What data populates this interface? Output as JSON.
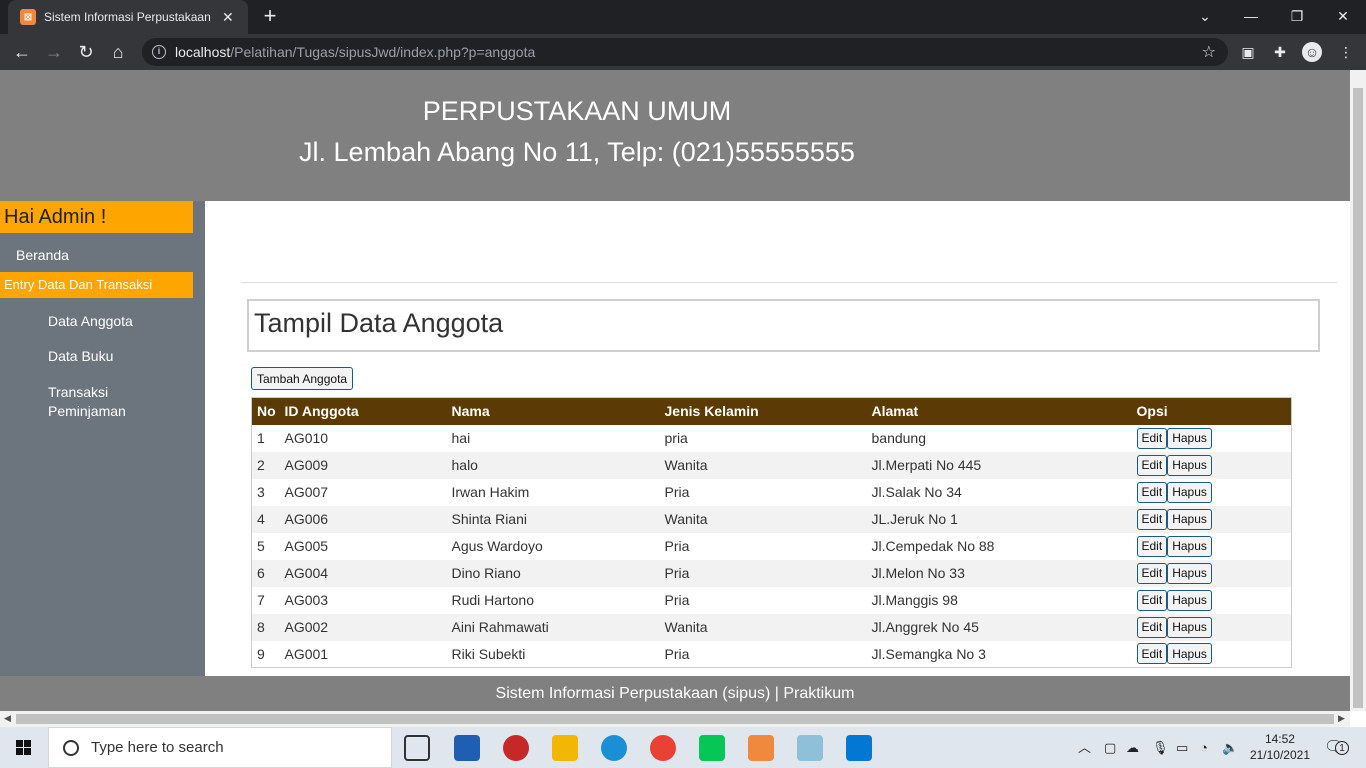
{
  "browser": {
    "tab_title": "Sistem Informasi Perpustakaan",
    "tab_close": "✕",
    "new_tab": "+",
    "url_host": "localhost",
    "url_path": "/Pelatihan/Tugas/sipusJwd/index.php?p=anggota"
  },
  "header": {
    "title": "PERPUSTAKAAN UMUM",
    "address": "Jl. Lembah Abang No 11, Telp: (021)55555555"
  },
  "sidebar": {
    "greeting": "Hai Admin !",
    "home": "Beranda",
    "section": "Entry Data Dan Transaksi",
    "items": [
      {
        "label": "Data Anggota"
      },
      {
        "label": "Data Buku"
      },
      {
        "label": "Transaksi Peminjaman"
      }
    ]
  },
  "main": {
    "page_title": "Tampil Data Anggota",
    "add_button": "Tambah Anggota",
    "columns": [
      "No",
      "ID Anggota",
      "Nama",
      "Jenis Kelamin",
      "Alamat",
      "Opsi"
    ],
    "edit_label": "Edit",
    "delete_label": "Hapus",
    "rows": [
      {
        "no": "1",
        "id": "AG010",
        "nama": "hai",
        "jk": "pria",
        "alamat": "bandung"
      },
      {
        "no": "2",
        "id": "AG009",
        "nama": "halo",
        "jk": "Wanita",
        "alamat": "Jl.Merpati No 445"
      },
      {
        "no": "3",
        "id": "AG007",
        "nama": "Irwan Hakim",
        "jk": "Pria",
        "alamat": "Jl.Salak No 34"
      },
      {
        "no": "4",
        "id": "AG006",
        "nama": "Shinta Riani",
        "jk": "Wanita",
        "alamat": "JL.Jeruk No 1"
      },
      {
        "no": "5",
        "id": "AG005",
        "nama": "Agus Wardoyo",
        "jk": "Pria",
        "alamat": "Jl.Cempedak No 88"
      },
      {
        "no": "6",
        "id": "AG004",
        "nama": "Dino Riano",
        "jk": "Pria",
        "alamat": "Jl.Melon No 33"
      },
      {
        "no": "7",
        "id": "AG003",
        "nama": "Rudi Hartono",
        "jk": "Pria",
        "alamat": "Jl.Manggis 98"
      },
      {
        "no": "8",
        "id": "AG002",
        "nama": "Aini Rahmawati",
        "jk": "Wanita",
        "alamat": "Jl.Anggrek No 45"
      },
      {
        "no": "9",
        "id": "AG001",
        "nama": "Riki Subekti",
        "jk": "Pria",
        "alamat": "Jl.Semangka No 3"
      }
    ]
  },
  "footer": {
    "text": "Sistem Informasi Perpustakaan (sipus) | Praktikum"
  },
  "taskbar": {
    "search_placeholder": "Type here to search",
    "time": "14:52",
    "date": "21/10/2021",
    "notification_count": "1"
  },
  "colors": {
    "header_bg": "#808080",
    "sidebar_bg": "#6c757d",
    "accent": "#ffa500",
    "table_header_bg": "#5c3a06"
  }
}
